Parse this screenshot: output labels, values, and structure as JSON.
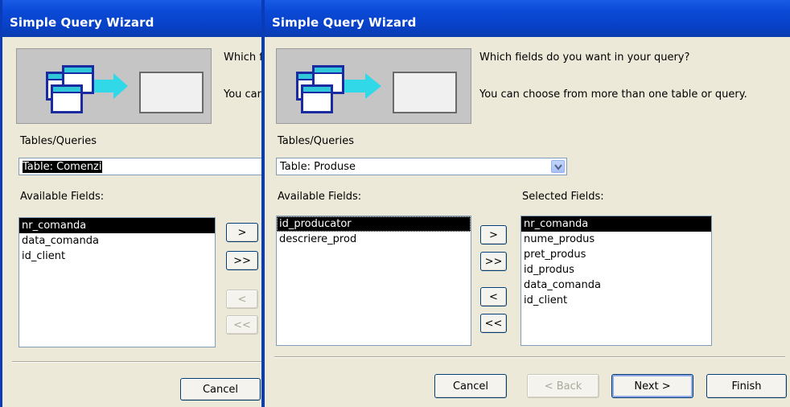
{
  "back_window": {
    "title": "Simple Query Wizard",
    "intro_line1": "Which f",
    "intro_line2": "You can",
    "tables_label": "Tables/Queries",
    "tables_value": "Table: Comenzi",
    "available_label": "Available Fields:",
    "available_fields": [
      "nr_comanda",
      "data_comanda",
      "id_client"
    ],
    "btn_add": ">",
    "btn_add_all": ">>",
    "btn_remove": "<",
    "btn_remove_all": "<<",
    "cancel": "Cancel"
  },
  "front_window": {
    "title": "Simple Query Wizard",
    "intro_line1": "Which fields do you want in your query?",
    "intro_line2": "You can choose from more than one table or query.",
    "tables_label": "Tables/Queries",
    "tables_value": "Table: Produse",
    "available_label": "Available Fields:",
    "available_fields": [
      "id_producator",
      "descriere_prod"
    ],
    "selected_label": "Selected Fields:",
    "selected_fields": [
      "nr_comanda",
      "nume_produs",
      "pret_produs",
      "id_produs",
      "data_comanda",
      "id_client"
    ],
    "btn_add": ">",
    "btn_add_all": ">>",
    "btn_remove": "<",
    "btn_remove_all": "<<",
    "cancel": "Cancel",
    "back": "< Back",
    "next": "Next >",
    "finish": "Finish"
  },
  "colors": {
    "titlebar": "#0a4ad6",
    "dialog_bg": "#ece9d8",
    "selection": "#000000"
  }
}
